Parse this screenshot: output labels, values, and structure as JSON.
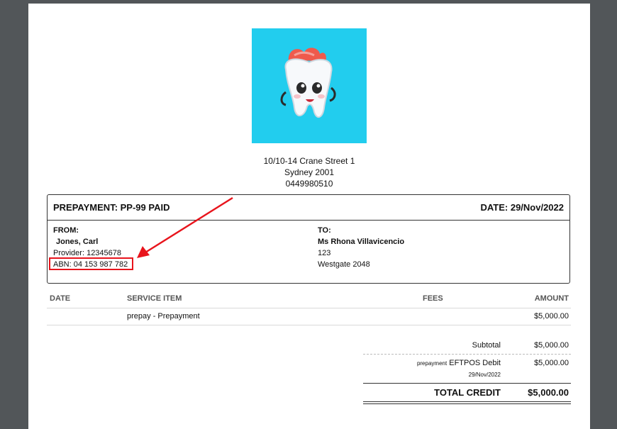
{
  "clinic": {
    "address_line1": "10/10-14 Crane Street 1",
    "address_line2": "Sydney 2001",
    "phone": "0449980510"
  },
  "receipt": {
    "title": "PREPAYMENT: PP-99 PAID",
    "date": "DATE: 29/Nov/2022"
  },
  "from": {
    "label": "FROM:",
    "name": "Jones, Carl",
    "provider": "Provider: 12345678",
    "abn": "ABN: 04 153 987 782"
  },
  "to": {
    "label": "TO:",
    "name": "Ms Rhona Villavicencio",
    "address_line1": "123",
    "address_line2": "Westgate 2048"
  },
  "table": {
    "headers": {
      "date": "DATE",
      "item": "SERVICE ITEM",
      "fees": "FEES",
      "amount": "AMOUNT"
    },
    "rows": [
      {
        "date": "",
        "item": "prepay - Prepayment",
        "fees": "",
        "amount": "$5,000.00"
      }
    ]
  },
  "summary": {
    "subtotal_label": "Subtotal",
    "subtotal_value": "$5,000.00",
    "payment_prefix": "prepayment",
    "payment_method": "EFTPOS Debit",
    "payment_date": "29/Nov/2022",
    "payment_amount": "$5,000.00",
    "total_label": "TOTAL CREDIT",
    "total_value": "$5,000.00"
  },
  "colors": {
    "logo_background": "#22cdee",
    "annotation_red": "#e8141c",
    "viewer_background": "#525659"
  },
  "logo": {
    "icon": "tooth-mascot-icon"
  }
}
